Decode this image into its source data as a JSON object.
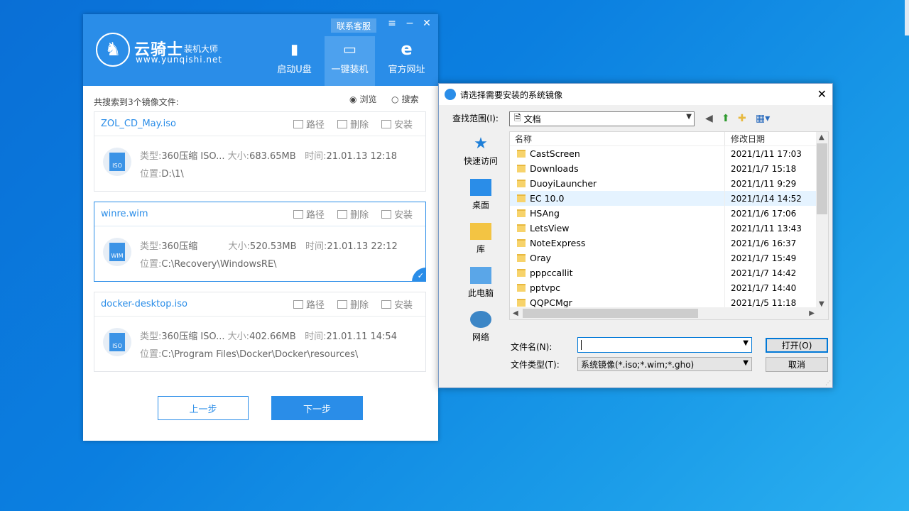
{
  "app": {
    "brand_title": "云骑士",
    "brand_sub": "装机大师",
    "brand_url": "www.yunqishi.net",
    "customer_service": "联系客服",
    "nav": [
      {
        "label": "启动U盘",
        "icon": "usb-icon"
      },
      {
        "label": "一键装机",
        "icon": "computer-icon",
        "active": true
      },
      {
        "label": "官方网址",
        "icon": "ie-icon"
      }
    ],
    "found_label": "共搜索到3个镜像文件:",
    "browse": "浏览",
    "search": "搜索",
    "actions": {
      "path": "路径",
      "delete": "删除",
      "install": "安装"
    },
    "files": [
      {
        "name": "ZOL_CD_May.iso",
        "ext": "ISO",
        "type_label": "类型:",
        "type": "360压缩 ISO...",
        "size_label": "大小:",
        "size": "683.65MB",
        "time_label": "时间:",
        "time": "21.01.13 12:18",
        "location_label": "位置:",
        "location": "D:\\1\\",
        "selected": false
      },
      {
        "name": "winre.wim",
        "ext": "WIM",
        "type_label": "类型:",
        "type": "360压缩",
        "size_label": "大小:",
        "size": "520.53MB",
        "time_label": "时间:",
        "time": "21.01.13 22:12",
        "location_label": "位置:",
        "location": "C:\\Recovery\\WindowsRE\\",
        "selected": true
      },
      {
        "name": "docker-desktop.iso",
        "ext": "ISO",
        "type_label": "类型:",
        "type": "360压缩 ISO...",
        "size_label": "大小:",
        "size": "402.66MB",
        "time_label": "时间:",
        "time": "21.01.11 14:54",
        "location_label": "位置:",
        "location": "C:\\Program Files\\Docker\\Docker\\resources\\",
        "selected": false
      }
    ],
    "prev_button": "上一步",
    "next_button": "下一步",
    "colors": {
      "primary": "#2a8de8"
    }
  },
  "dialog": {
    "title": "请选择需要安装的系统镜像",
    "look_in_label": "查找范围(I):",
    "look_in_value": "文档",
    "places": [
      {
        "label": "快速访问",
        "icon": "star-icon"
      },
      {
        "label": "桌面",
        "icon": "desktop-icon"
      },
      {
        "label": "库",
        "icon": "library-icon"
      },
      {
        "label": "此电脑",
        "icon": "computer-icon"
      },
      {
        "label": "网络",
        "icon": "network-icon"
      }
    ],
    "columns": {
      "name": "名称",
      "date": "修改日期"
    },
    "rows": [
      {
        "name": "CastScreen",
        "date": "2021/1/11 17:03"
      },
      {
        "name": "Downloads",
        "date": "2021/1/7 15:18"
      },
      {
        "name": "DuoyiLauncher",
        "date": "2021/1/11 9:29"
      },
      {
        "name": "EC 10.0",
        "date": "2021/1/14 14:52",
        "highlight": true
      },
      {
        "name": "HSAng",
        "date": "2021/1/6 17:06"
      },
      {
        "name": "LetsView",
        "date": "2021/1/11 13:43"
      },
      {
        "name": "NoteExpress",
        "date": "2021/1/6 16:37"
      },
      {
        "name": "Oray",
        "date": "2021/1/7 15:49"
      },
      {
        "name": "pppccallit",
        "date": "2021/1/7 14:42"
      },
      {
        "name": "pptvpc",
        "date": "2021/1/7 14:40"
      },
      {
        "name": "QQPCMgr",
        "date": "2021/1/5 11:18"
      }
    ],
    "filename_label": "文件名(N):",
    "filename_value": "",
    "filetype_label": "文件类型(T):",
    "filetype_value": "系统镜像(*.iso;*.wim;*.gho)",
    "open_button": "打开(O)",
    "cancel_button": "取消"
  }
}
